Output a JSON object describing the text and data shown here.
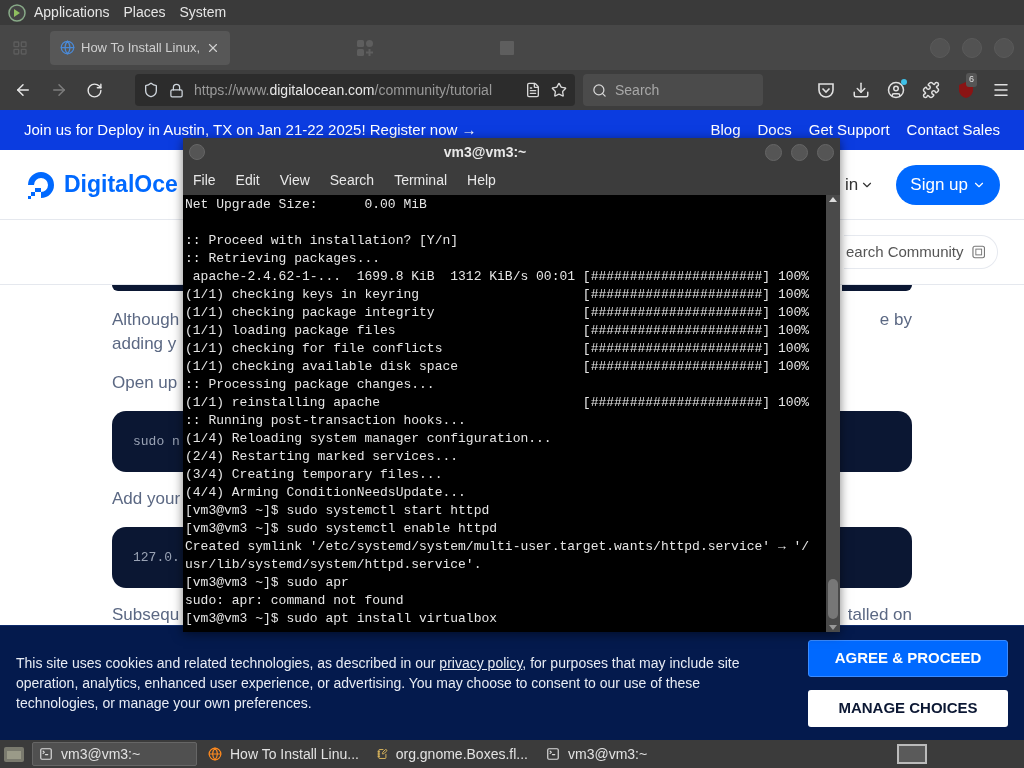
{
  "desktop_panel": {
    "menus": [
      "Applications",
      "Places",
      "System"
    ]
  },
  "browser": {
    "tabs": [
      {
        "label": "How To Install Linux, ",
        "selected": true
      }
    ],
    "url": {
      "scheme": "https://www.",
      "host": "digitalocean.com",
      "path": "/community/tutorial"
    },
    "search_placeholder": "Search",
    "extension_badge": "6"
  },
  "page": {
    "banner": {
      "text": "Join us for Deploy in Austin, TX on Jan 21-22 2025! Register now →",
      "links": [
        "Blog",
        "Docs",
        "Get Support",
        "Contact Sales"
      ]
    },
    "header": {
      "logo_text": "DigitalOce",
      "menu_fragment": "in",
      "signup": "Sign up"
    },
    "community_search": {
      "placeholder": "earch Community"
    },
    "content": [
      {
        "kind": "paragraph",
        "lines": [
          {
            "left": "Although",
            "right": "e by"
          },
          {
            "left": "adding y"
          }
        ]
      },
      {
        "kind": "paragraph",
        "lines": [
          {
            "left": "Open up"
          }
        ]
      },
      {
        "kind": "code",
        "text": "sudo n"
      },
      {
        "kind": "paragraph",
        "lines": [
          {
            "left": "Add your"
          }
        ]
      },
      {
        "kind": "code",
        "text": "127.0."
      },
      {
        "kind": "paragraph",
        "lines": [
          {
            "left": "Subsequ",
            "right": "talled on"
          }
        ]
      }
    ]
  },
  "terminal": {
    "title": "vm3@vm3:~",
    "menu": [
      "File",
      "Edit",
      "View",
      "Search",
      "Terminal",
      "Help"
    ],
    "blocks": [
      [
        "Net Upgrade Size:      0.00 MiB"
      ],
      [
        ":: Proceed with installation? [Y/n]",
        ":: Retrieving packages...",
        " apache-2.4.62-1-...  1699.8 KiB  1312 KiB/s 00:01 [######################] 100%",
        "(1/1) checking keys in keyring                     [######################] 100%",
        "(1/1) checking package integrity                   [######################] 100%",
        "(1/1) loading package files                        [######################] 100%",
        "(1/1) checking for file conflicts                  [######################] 100%",
        "(1/1) checking available disk space                [######################] 100%",
        ":: Processing package changes...",
        "(1/1) reinstalling apache                          [######################] 100%",
        ":: Running post-transaction hooks...",
        "(1/4) Reloading system manager configuration...",
        "(2/4) Restarting marked services...",
        "(3/4) Creating temporary files...",
        "(4/4) Arming ConditionNeedsUpdate...",
        "[vm3@vm3 ~]$ sudo systemctl start httpd",
        "[vm3@vm3 ~]$ sudo systemctl enable httpd",
        "Created symlink '/etc/systemd/system/multi-user.target.wants/httpd.service' → '/",
        "usr/lib/systemd/system/httpd.service'.",
        "[vm3@vm3 ~]$ sudo apr",
        "sudo: apr: command not found",
        "[vm3@vm3 ~]$ sudo apt install virtualbox"
      ]
    ]
  },
  "cookie_banner": {
    "text_before": "This site uses cookies and related technologies, as described in our ",
    "link": "privacy policy",
    "text_after": ", for purposes that may include site operation, analytics, enhanced user experience, or advertising. You may choose to consent to our use of these technologies, or manage your own preferences.",
    "buttons": [
      {
        "label": "AGREE & PROCEED",
        "kind": "primary"
      },
      {
        "label": "MANAGE CHOICES",
        "kind": "secondary"
      }
    ]
  },
  "taskbar": {
    "items": [
      {
        "label": "vm3@vm3:~",
        "kind": "terminal",
        "selected": true
      },
      {
        "label": "How To Install Linu...",
        "kind": "browser",
        "selected": false
      },
      {
        "label": "org.gnome.Boxes.fl...",
        "kind": "editor",
        "selected": false
      },
      {
        "label": "vm3@vm3:~",
        "kind": "terminal",
        "selected": false
      }
    ]
  }
}
